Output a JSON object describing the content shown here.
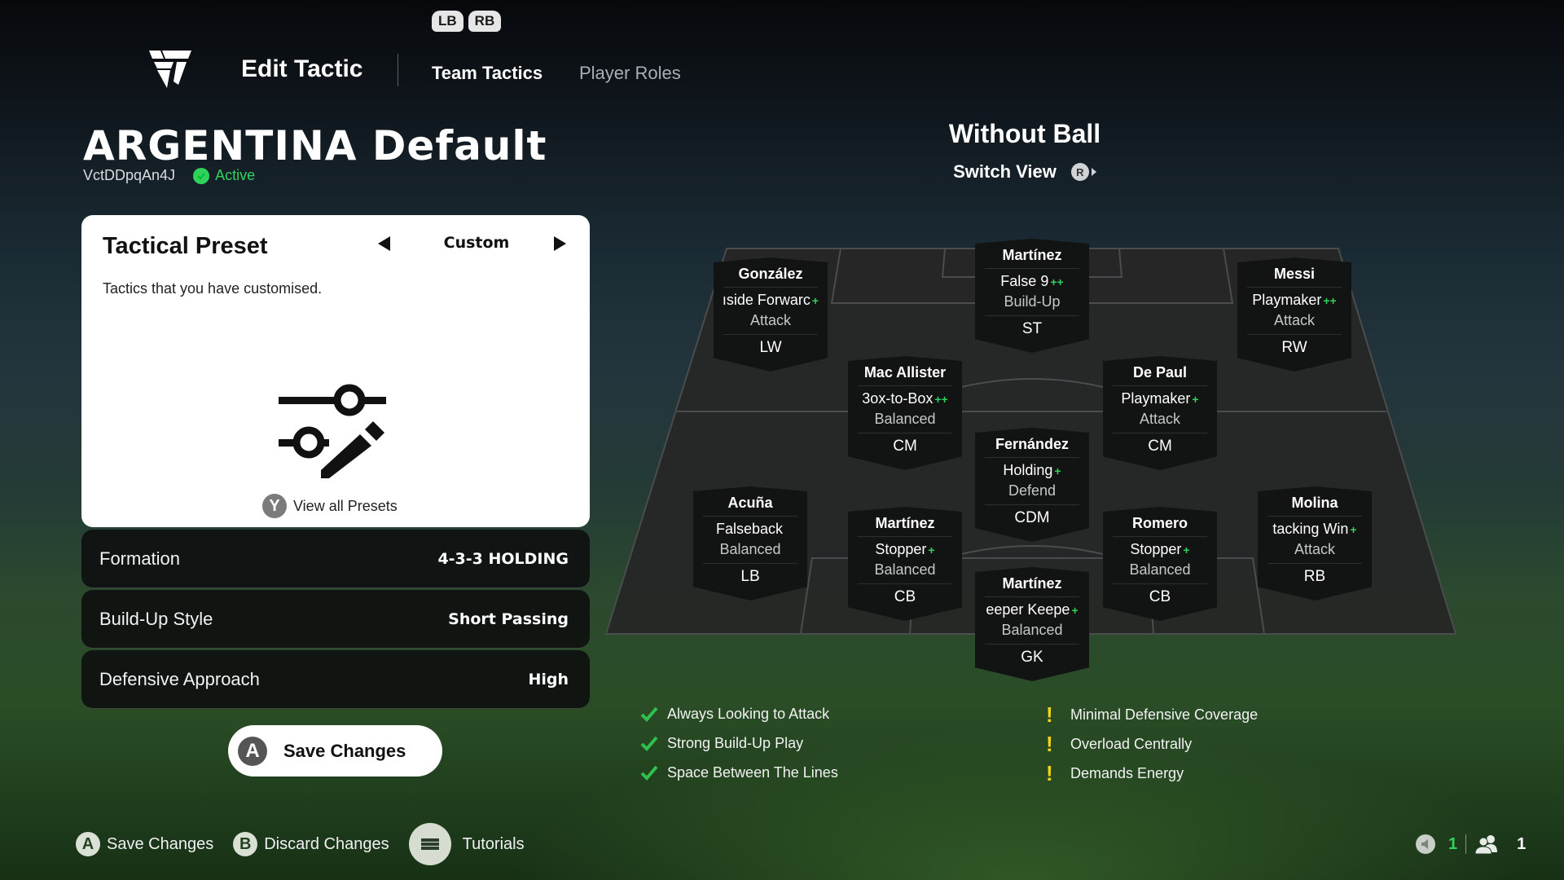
{
  "header": {
    "bumpers": [
      "LB",
      "RB"
    ],
    "logo": "ea-fc-logo",
    "page_title": "Edit Tactic",
    "tabs": [
      {
        "label": "Team Tactics",
        "active": true
      },
      {
        "label": "Player Roles",
        "active": false
      }
    ]
  },
  "tactic": {
    "name": "ARGENTINA Default",
    "code": "VctDDpqAn4J",
    "status": "Active"
  },
  "preset": {
    "title": "Tactical Preset",
    "value": "Custom",
    "description": "Tactics that you have customised.",
    "icon": "sliders-edit-icon",
    "view_all_button": "Y",
    "view_all_label": "View all Presets"
  },
  "settings": [
    {
      "label": "Formation",
      "value": "4-3-3 HOLDING"
    },
    {
      "label": "Build-Up Style",
      "value": "Short Passing"
    },
    {
      "label": "Defensive Approach",
      "value": "High"
    }
  ],
  "save_button": {
    "key": "A",
    "label": "Save Changes"
  },
  "hints": [
    {
      "key": "A",
      "label": "Save Changes"
    },
    {
      "key": "menu",
      "label": "Discard Changes",
      "bkey": "B"
    },
    {
      "key": "menu-icon",
      "label": "Tutorials"
    }
  ],
  "hint_labels": {
    "save": "Save Changes",
    "save_key": "A",
    "discard": "Discard Changes",
    "discard_key": "B",
    "tutorials": "Tutorials"
  },
  "status_bar": {
    "muted_count": "1",
    "party_count": "1"
  },
  "view": {
    "title": "Without Ball",
    "switch_label": "Switch View",
    "switch_key": "R"
  },
  "players": [
    {
      "name": "González",
      "role": "Inside Forward",
      "role_display": "ıside Forwarc",
      "plus": "+",
      "focus": "Attack",
      "position": "LW"
    },
    {
      "name": "Martínez",
      "role": "False 9",
      "role_display": "False 9",
      "plus": "++",
      "focus": "Build-Up",
      "position": "ST"
    },
    {
      "name": "Messi",
      "role": "Playmaker",
      "role_display": "Playmaker",
      "plus": "++",
      "focus": "Attack",
      "position": "RW"
    },
    {
      "name": "Mac Allister",
      "role": "Box-to-Box",
      "role_display": "3ox-to-Box",
      "plus": "++",
      "focus": "Balanced",
      "position": "CM"
    },
    {
      "name": "De Paul",
      "role": "Playmaker",
      "role_display": "Playmaker",
      "plus": "+",
      "focus": "Attack",
      "position": "CM"
    },
    {
      "name": "Fernández",
      "role": "Holding",
      "role_display": "Holding",
      "plus": "+",
      "focus": "Defend",
      "position": "CDM"
    },
    {
      "name": "Acuña",
      "role": "Falseback",
      "role_display": "Falseback",
      "plus": "",
      "focus": "Balanced",
      "position": "LB"
    },
    {
      "name": "Martínez",
      "role": "Stopper",
      "role_display": "Stopper",
      "plus": "+",
      "focus": "Balanced",
      "position": "CB"
    },
    {
      "name": "Romero",
      "role": "Stopper",
      "role_display": "Stopper",
      "plus": "+",
      "focus": "Balanced",
      "position": "CB"
    },
    {
      "name": "Molina",
      "role": "Attacking Wingback",
      "role_display": "tacking Win",
      "plus": "+",
      "focus": "Attack",
      "position": "RB"
    },
    {
      "name": "Martínez",
      "role": "Sweeper Keeper",
      "role_display": "eeper Keepe",
      "plus": "+",
      "focus": "Balanced",
      "position": "GK"
    }
  ],
  "strengths": [
    "Always Looking to Attack",
    "Strong Build-Up Play",
    "Space Between The Lines"
  ],
  "weaknesses": [
    "Minimal Defensive Coverage",
    "Overload Centrally",
    "Demands Energy"
  ],
  "colors": {
    "accent_green": "#2fd35c",
    "warning_yellow": "#f2d21b",
    "card_bg": "#121313",
    "pitch": "#262727"
  }
}
